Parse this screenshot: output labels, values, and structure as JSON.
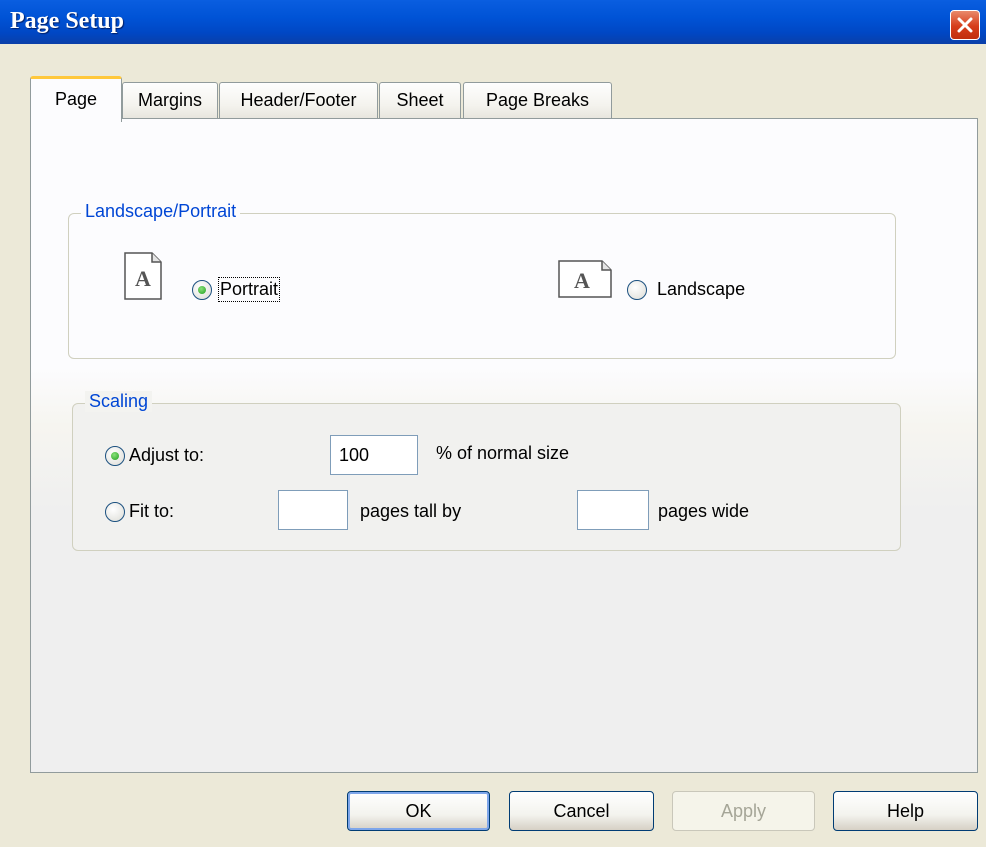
{
  "window": {
    "title": "Page Setup"
  },
  "tabs": [
    {
      "label": "Page",
      "active": true
    },
    {
      "label": "Margins"
    },
    {
      "label": "Header/Footer"
    },
    {
      "label": "Sheet"
    },
    {
      "label": "Page Breaks"
    }
  ],
  "orientation": {
    "group_title": "Landscape/Portrait",
    "portrait_label": "Portrait",
    "landscape_label": "Landscape",
    "icon_letter": "A",
    "selected": "Portrait"
  },
  "scaling": {
    "group_title": "Scaling",
    "adjust_label": "Adjust to:",
    "adjust_value": "100",
    "adjust_suffix": "% of normal size",
    "fit_label": "Fit to:",
    "fit_tall_value": "",
    "fit_tall_suffix": "pages tall by",
    "fit_wide_value": "",
    "fit_wide_suffix": "pages wide",
    "selected": "Adjust to:"
  },
  "buttons": {
    "ok": "OK",
    "cancel": "Cancel",
    "apply": "Apply",
    "help": "Help"
  },
  "colors": {
    "titlebar": "#0053d6",
    "group_title": "#0046d5",
    "active_tab_highlight": "#ffc83c",
    "radio_selected": "#21a121"
  }
}
